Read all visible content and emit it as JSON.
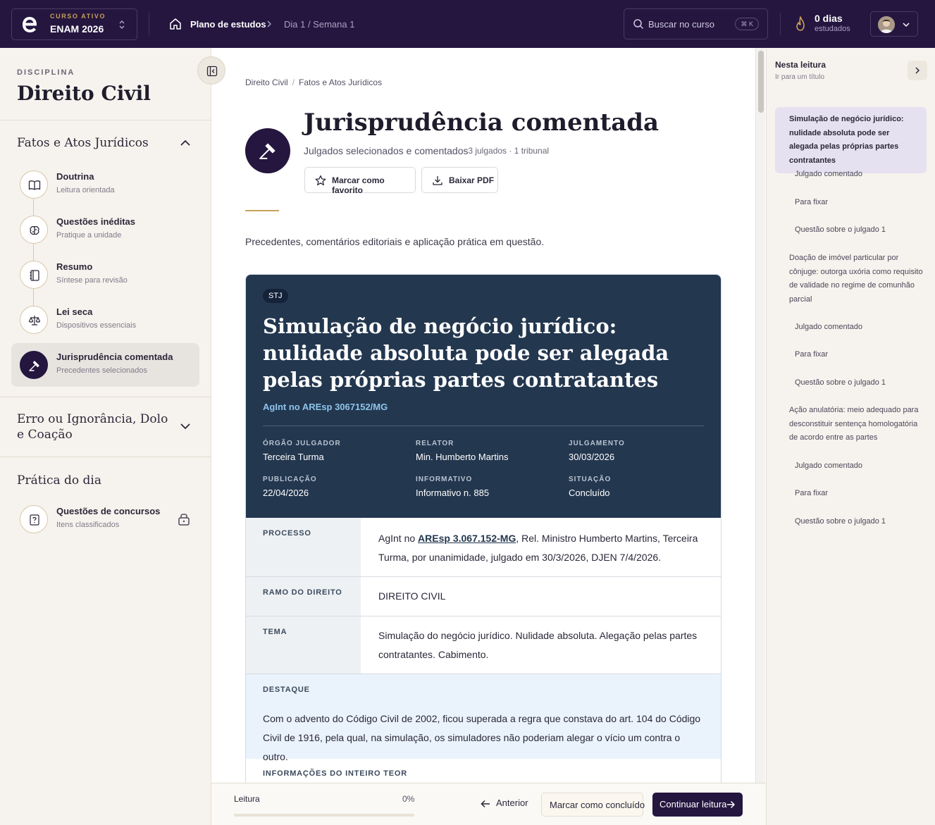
{
  "topbar": {
    "course_label": "CURSO ATIVO",
    "course_name": "ENAM 2026",
    "breadcrumb_plan": "Plano de estudos",
    "breadcrumb_day": "Dia 1 / Semana 1",
    "search_placeholder": "Buscar no curso",
    "search_shortcut": "⌘ K",
    "streak_value": "0 dias",
    "streak_label": "estudados"
  },
  "sidebar": {
    "discipline_label": "DISCIPLINA",
    "discipline_name": "Direito Civil",
    "section1_title": "Fatos e Atos Jurídicos",
    "items": [
      {
        "title": "Doutrina",
        "subtitle": "Leitura orientada",
        "icon": "book-icon"
      },
      {
        "title": "Questões inéditas",
        "subtitle": "Pratique a unidade",
        "icon": "brain-icon"
      },
      {
        "title": "Resumo",
        "subtitle": "Síntese para revisão",
        "icon": "notebook-icon"
      },
      {
        "title": "Lei seca",
        "subtitle": "Dispositivos essenciais",
        "icon": "scale-icon"
      },
      {
        "title": "Jurisprudência comentada",
        "subtitle": "Precedentes selecionados",
        "icon": "gavel-icon"
      }
    ],
    "section2_title": "Erro ou Ignorância, Dolo e Coação",
    "section3_title": "Prática do dia",
    "practice_item": {
      "title": "Questões de concursos",
      "subtitle": "Itens classificados"
    }
  },
  "main": {
    "breadcrumb": [
      "Direito Civil",
      "Fatos e Atos Jurídicos"
    ],
    "title": "Jurisprudência comentada",
    "subtitle": "Julgados selecionados e comentados",
    "meta": "· 3 julgados · 1 tribunal",
    "favorite_label": "Marcar como favorito",
    "pdf_label": "Baixar PDF",
    "intro": "Precedentes, comentários editoriais e aplicação prática em questão.",
    "card": {
      "court": "STJ",
      "title": "Simulação de negócio jurídico: nulidade absoluta pode ser alegada pelas próprias partes contratantes",
      "process_code": "AgInt no AREsp 3067152/MG",
      "meta": [
        {
          "label": "ÓRGÃO JULGADOR",
          "value": "Terceira Turma"
        },
        {
          "label": "RELATOR",
          "value": "Min. Humberto Martins"
        },
        {
          "label": "JULGAMENTO",
          "value": "30/03/2026"
        },
        {
          "label": "PUBLICAÇÃO",
          "value": "22/04/2026"
        },
        {
          "label": "INFORMATIVO",
          "value": "Informativo n. 885"
        },
        {
          "label": "SITUAÇÃO",
          "value": "Concluído"
        }
      ],
      "processo_label": "PROCESSO",
      "processo_prefix": "AgInt no ",
      "processo_link": "AREsp 3.067.152-MG",
      "processo_suffix": ", Rel. Ministro Humberto Martins, Terceira Turma, por unanimidade, julgado em 30/3/2026, DJEN 7/4/2026.",
      "ramo_label": "RAMO DO DIREITO",
      "ramo_value": "DIREITO CIVIL",
      "tema_label": "TEMA",
      "tema_value": "Simulação do negócio jurídico. Nulidade absoluta. Alegação pelas partes contratantes. Cabimento.",
      "destaque_label": "DESTAQUE",
      "destaque_text": "Com o advento do Código Civil de 2002, ficou superada a regra que constava do art. 104 do Código Civil de 1916, pela qual, na simulação, os simuladores não poderiam alegar o vício um contra o outro.",
      "inteiro_label": "INFORMAÇÕES DO INTEIRO TEOR"
    }
  },
  "bottombar": {
    "progress_label": "Leitura",
    "progress_text": "0%",
    "progress_value": 0,
    "prev_label": "Anterior",
    "done_label": "Marcar como concluído",
    "continue_label": "Continuar leitura"
  },
  "toc": {
    "title": "Nesta leitura",
    "subtitle": "Ir para um título",
    "items": [
      "Simulação de negócio jurídico: nulidade absoluta pode ser alegada pelas próprias partes contratantes",
      "Julgado comentado",
      "Para fixar",
      "Questão sobre o julgado 1",
      "Doação de imóvel particular por cônjuge: outorga uxória como requisito de validade no regime de comunhão parcial",
      "Julgado comentado",
      "Para fixar",
      "Questão sobre o julgado 1",
      "Ação anulatória: meio adequado para desconstituir sentença homologatória de acordo entre as partes",
      "Julgado comentado",
      "Para fixar",
      "Questão sobre o julgado 1"
    ]
  },
  "colors": {
    "topbar": "#24163f",
    "accent_gold": "#c8a15a",
    "card_header": "#23374f",
    "link_blue": "#8ec4ec"
  }
}
